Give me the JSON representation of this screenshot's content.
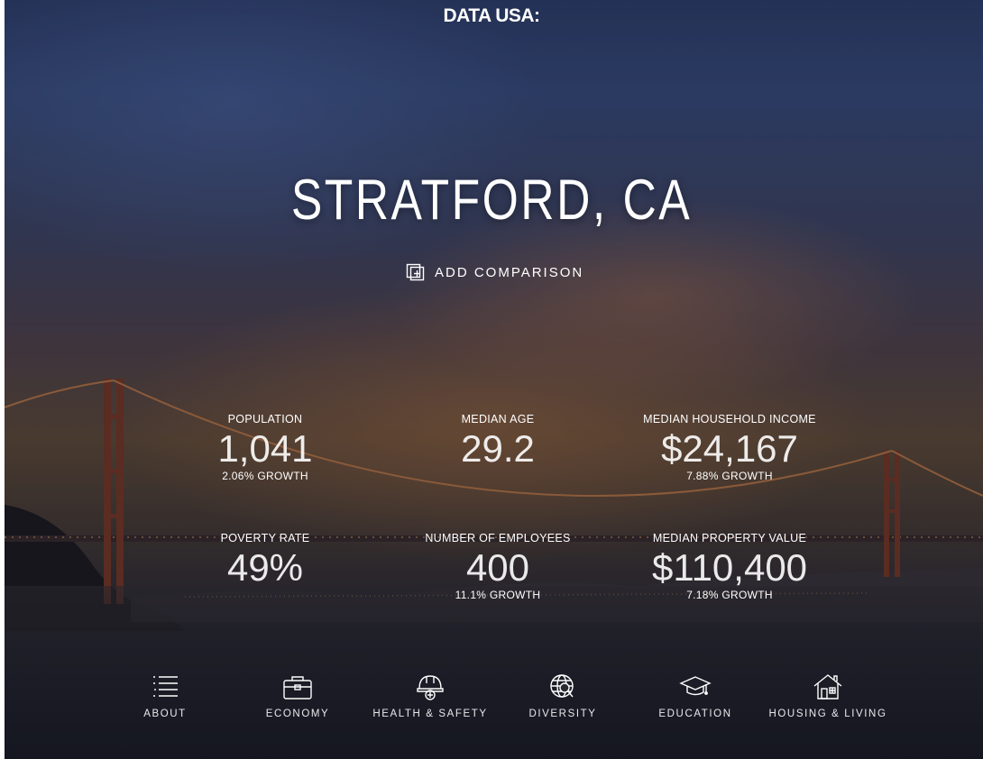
{
  "logo": "DATA USA:",
  "place": {
    "title": "STRATFORD, CA"
  },
  "compare": {
    "label": "ADD COMPARISON"
  },
  "stats": [
    {
      "label": "POPULATION",
      "value": "1,041",
      "growth": "2.06% GROWTH"
    },
    {
      "label": "MEDIAN AGE",
      "value": "29.2",
      "growth": ""
    },
    {
      "label": "MEDIAN HOUSEHOLD INCOME",
      "value": "$24,167",
      "growth": "7.88% GROWTH"
    },
    {
      "label": "POVERTY RATE",
      "value": "49%",
      "growth": ""
    },
    {
      "label": "NUMBER OF EMPLOYEES",
      "value": "400",
      "growth": "11.1% GROWTH"
    },
    {
      "label": "MEDIAN PROPERTY VALUE",
      "value": "$110,400",
      "growth": "7.18% GROWTH"
    }
  ],
  "nav": [
    {
      "label": "ABOUT",
      "icon": "list-icon"
    },
    {
      "label": "ECONOMY",
      "icon": "briefcase-icon"
    },
    {
      "label": "HEALTH & SAFETY",
      "icon": "helmet-icon"
    },
    {
      "label": "DIVERSITY",
      "icon": "globe-search-icon"
    },
    {
      "label": "EDUCATION",
      "icon": "graduation-cap-icon"
    },
    {
      "label": "HOUSING & LIVING",
      "icon": "house-icon"
    }
  ]
}
